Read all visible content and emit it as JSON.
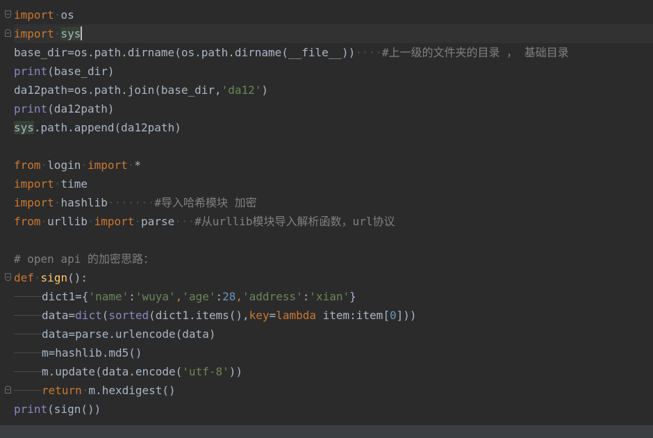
{
  "editor": {
    "language": "python",
    "colors": {
      "background": "#2b2b2b",
      "keyword": "#cc7832",
      "string": "#6a8759",
      "number": "#6897bb",
      "comment": "#808080",
      "builtin": "#8888c6",
      "function_name": "#ffc66d",
      "default_text": "#a9b7c6"
    },
    "lines": {
      "l1": {
        "kw": "import",
        "rest": "os"
      },
      "l2": {
        "kw": "import",
        "rest": "sys"
      },
      "l3": {
        "code": "base_dir=os.path.dirname(os.path.dirname(__file__))",
        "dots": "····",
        "comment": "#上一级的文件夹的目录 ， 基础目录"
      },
      "l4": {
        "func": "print",
        "rest": "(base_dir)"
      },
      "l5": {
        "code": "da12path=os.path.join(base_dir,",
        "str": "'da12'",
        "close": ")"
      },
      "l6": {
        "func": "print",
        "rest": "(da12path)"
      },
      "l7": {
        "mod": "sys",
        "rest": ".path.append(da12path)"
      },
      "l9": {
        "kw1": "from",
        "mod": "login",
        "kw2": "import",
        "rest": "*"
      },
      "l10": {
        "kw": "import",
        "rest": "time"
      },
      "l11": {
        "kw": "import",
        "rest": "hashlib",
        "dots": "·······",
        "comment": "#导入哈希模块 加密"
      },
      "l12": {
        "kw1": "from",
        "mod": "urllib",
        "kw2": "import",
        "rest": "parse",
        "dots": "···",
        "comment": "#从urllib模块导入解析函数，url协议"
      },
      "l14": {
        "comment": "# open api 的加密思路："
      },
      "l15": {
        "kw": "def",
        "name": "sign",
        "rest": "():"
      },
      "l16": {
        "a": "dict1={",
        "s1": "'name'",
        "c1": ":",
        "s2": "'wuya'",
        "c2": ",",
        "s3": "'age'",
        "c3": ":",
        "n1": "28",
        "c4": ",",
        "s4": "'address'",
        "c5": ":",
        "s5": "'xian'",
        "close": "}"
      },
      "l17": {
        "a": "data=",
        "b1": "dict",
        "p1": "(",
        "b2": "sorted",
        "p2": "(dict1.items(),",
        "k1": "key",
        "eq": "=",
        "k2": "lambda",
        "p3": " item:item[",
        "n1": "0",
        "p4": "]))"
      },
      "l18": {
        "code": "data=parse.urlencode(data)"
      },
      "l19": {
        "code": "m=hashlib.md5()"
      },
      "l20": {
        "a": "m.update(data.encode(",
        "s": "'utf-8'",
        "close": "))"
      },
      "l21": {
        "kw": "return",
        "rest": "m.hexdigest()"
      },
      "l22": {
        "func": "print",
        "rest": "(sign())"
      }
    }
  }
}
